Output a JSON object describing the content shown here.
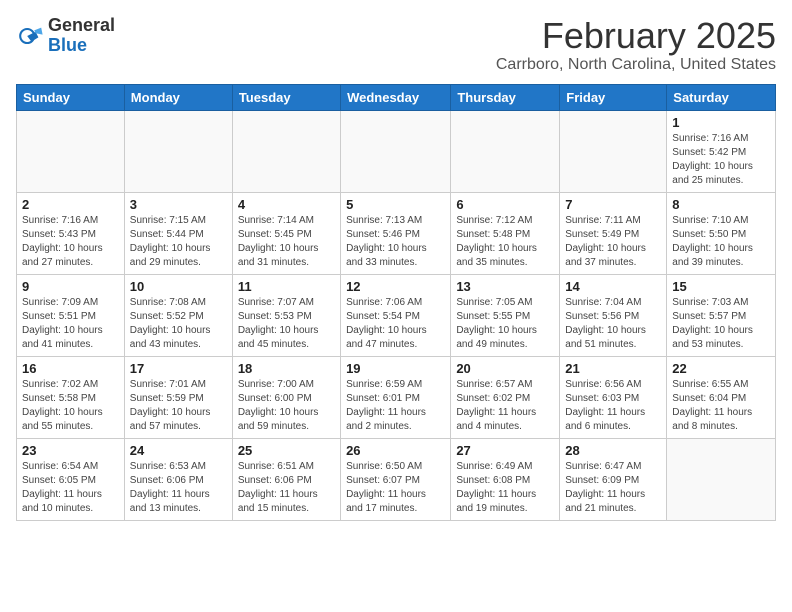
{
  "header": {
    "logo_general": "General",
    "logo_blue": "Blue",
    "title": "February 2025",
    "subtitle": "Carrboro, North Carolina, United States"
  },
  "weekdays": [
    "Sunday",
    "Monday",
    "Tuesday",
    "Wednesday",
    "Thursday",
    "Friday",
    "Saturday"
  ],
  "weeks": [
    [
      {
        "day": "",
        "info": ""
      },
      {
        "day": "",
        "info": ""
      },
      {
        "day": "",
        "info": ""
      },
      {
        "day": "",
        "info": ""
      },
      {
        "day": "",
        "info": ""
      },
      {
        "day": "",
        "info": ""
      },
      {
        "day": "1",
        "info": "Sunrise: 7:16 AM\nSunset: 5:42 PM\nDaylight: 10 hours and 25 minutes."
      }
    ],
    [
      {
        "day": "2",
        "info": "Sunrise: 7:16 AM\nSunset: 5:43 PM\nDaylight: 10 hours and 27 minutes."
      },
      {
        "day": "3",
        "info": "Sunrise: 7:15 AM\nSunset: 5:44 PM\nDaylight: 10 hours and 29 minutes."
      },
      {
        "day": "4",
        "info": "Sunrise: 7:14 AM\nSunset: 5:45 PM\nDaylight: 10 hours and 31 minutes."
      },
      {
        "day": "5",
        "info": "Sunrise: 7:13 AM\nSunset: 5:46 PM\nDaylight: 10 hours and 33 minutes."
      },
      {
        "day": "6",
        "info": "Sunrise: 7:12 AM\nSunset: 5:48 PM\nDaylight: 10 hours and 35 minutes."
      },
      {
        "day": "7",
        "info": "Sunrise: 7:11 AM\nSunset: 5:49 PM\nDaylight: 10 hours and 37 minutes."
      },
      {
        "day": "8",
        "info": "Sunrise: 7:10 AM\nSunset: 5:50 PM\nDaylight: 10 hours and 39 minutes."
      }
    ],
    [
      {
        "day": "9",
        "info": "Sunrise: 7:09 AM\nSunset: 5:51 PM\nDaylight: 10 hours and 41 minutes."
      },
      {
        "day": "10",
        "info": "Sunrise: 7:08 AM\nSunset: 5:52 PM\nDaylight: 10 hours and 43 minutes."
      },
      {
        "day": "11",
        "info": "Sunrise: 7:07 AM\nSunset: 5:53 PM\nDaylight: 10 hours and 45 minutes."
      },
      {
        "day": "12",
        "info": "Sunrise: 7:06 AM\nSunset: 5:54 PM\nDaylight: 10 hours and 47 minutes."
      },
      {
        "day": "13",
        "info": "Sunrise: 7:05 AM\nSunset: 5:55 PM\nDaylight: 10 hours and 49 minutes."
      },
      {
        "day": "14",
        "info": "Sunrise: 7:04 AM\nSunset: 5:56 PM\nDaylight: 10 hours and 51 minutes."
      },
      {
        "day": "15",
        "info": "Sunrise: 7:03 AM\nSunset: 5:57 PM\nDaylight: 10 hours and 53 minutes."
      }
    ],
    [
      {
        "day": "16",
        "info": "Sunrise: 7:02 AM\nSunset: 5:58 PM\nDaylight: 10 hours and 55 minutes."
      },
      {
        "day": "17",
        "info": "Sunrise: 7:01 AM\nSunset: 5:59 PM\nDaylight: 10 hours and 57 minutes."
      },
      {
        "day": "18",
        "info": "Sunrise: 7:00 AM\nSunset: 6:00 PM\nDaylight: 10 hours and 59 minutes."
      },
      {
        "day": "19",
        "info": "Sunrise: 6:59 AM\nSunset: 6:01 PM\nDaylight: 11 hours and 2 minutes."
      },
      {
        "day": "20",
        "info": "Sunrise: 6:57 AM\nSunset: 6:02 PM\nDaylight: 11 hours and 4 minutes."
      },
      {
        "day": "21",
        "info": "Sunrise: 6:56 AM\nSunset: 6:03 PM\nDaylight: 11 hours and 6 minutes."
      },
      {
        "day": "22",
        "info": "Sunrise: 6:55 AM\nSunset: 6:04 PM\nDaylight: 11 hours and 8 minutes."
      }
    ],
    [
      {
        "day": "23",
        "info": "Sunrise: 6:54 AM\nSunset: 6:05 PM\nDaylight: 11 hours and 10 minutes."
      },
      {
        "day": "24",
        "info": "Sunrise: 6:53 AM\nSunset: 6:06 PM\nDaylight: 11 hours and 13 minutes."
      },
      {
        "day": "25",
        "info": "Sunrise: 6:51 AM\nSunset: 6:06 PM\nDaylight: 11 hours and 15 minutes."
      },
      {
        "day": "26",
        "info": "Sunrise: 6:50 AM\nSunset: 6:07 PM\nDaylight: 11 hours and 17 minutes."
      },
      {
        "day": "27",
        "info": "Sunrise: 6:49 AM\nSunset: 6:08 PM\nDaylight: 11 hours and 19 minutes."
      },
      {
        "day": "28",
        "info": "Sunrise: 6:47 AM\nSunset: 6:09 PM\nDaylight: 11 hours and 21 minutes."
      },
      {
        "day": "",
        "info": ""
      }
    ]
  ]
}
